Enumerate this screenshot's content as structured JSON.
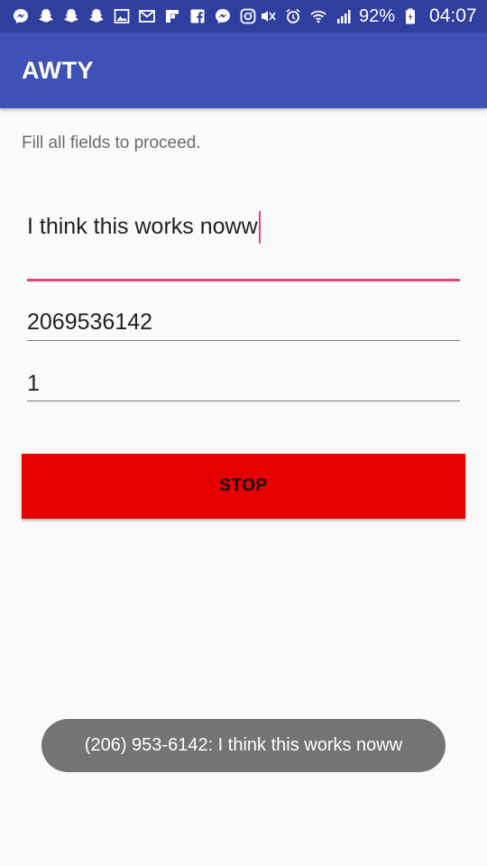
{
  "status_bar": {
    "left_icons": [
      "messenger-icon",
      "snapchat-icon",
      "snapchat-icon",
      "snapchat-icon",
      "gallery-icon",
      "gmail-icon",
      "flipboard-icon",
      "facebook-icon",
      "messenger-icon",
      "instagram-icon"
    ],
    "right_icons": [
      "mute-vibrate-icon",
      "alarm-icon",
      "wifi-icon",
      "signal-icon",
      "battery-charging-icon"
    ],
    "battery_percent": "92%",
    "time": "04:07",
    "background": "#303f9f"
  },
  "app_bar": {
    "title": "AWTY",
    "background": "#3f51b5"
  },
  "form": {
    "instructions": "Fill all fields to proceed.",
    "message_value": "I think this works noww",
    "phone_value": "2069536142",
    "minutes_value": "1",
    "accent_color": "#e8407c"
  },
  "stop_button": {
    "label": "STOP",
    "background": "#e60000"
  },
  "toast": {
    "text": "(206) 953-6142: I think this works noww"
  }
}
